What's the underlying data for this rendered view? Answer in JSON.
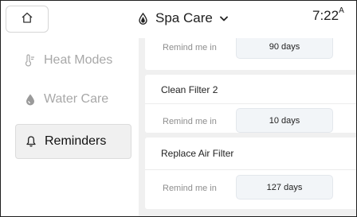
{
  "header": {
    "title": "Spa Care",
    "clock": "7:22",
    "clock_suffix": "A"
  },
  "icons": {
    "home": "home-icon",
    "drop": "water-drop-icon",
    "chevron": "chevron-down-icon",
    "heat": "thermometer-icon",
    "water_care": "water-care-icon",
    "reminders": "bell-icon"
  },
  "sidebar": {
    "items": [
      {
        "label": "Heat Modes",
        "active": false
      },
      {
        "label": "Water Care",
        "active": false
      },
      {
        "label": "Reminders",
        "active": true
      }
    ]
  },
  "reminders": [
    {
      "title": "",
      "remind_label": "Remind me in",
      "value": "90 days"
    },
    {
      "title": "Clean Filter 2",
      "remind_label": "Remind me in",
      "value": "10 days"
    },
    {
      "title": "Replace Air Filter",
      "remind_label": "Remind me in",
      "value": "127 days"
    }
  ],
  "colors": {
    "active_background": "#f0f0f0",
    "inactive_text": "#a8a8a8",
    "content_background": "#f0f0f0",
    "days_field_background": "#f2f5f8"
  }
}
